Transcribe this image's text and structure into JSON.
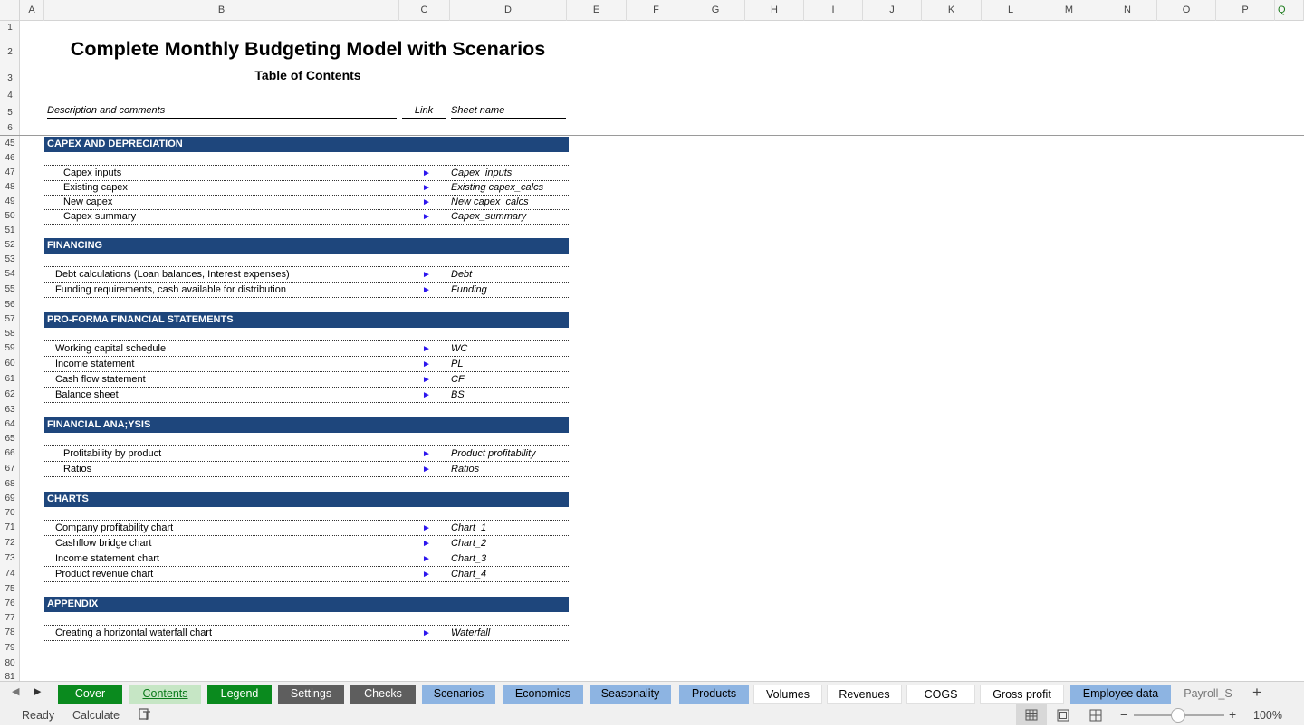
{
  "columns": [
    "A",
    "B",
    "C",
    "D",
    "E",
    "F",
    "G",
    "H",
    "I",
    "J",
    "K",
    "L",
    "M",
    "N",
    "O",
    "P",
    "Q"
  ],
  "rows_top": [
    "1",
    "2",
    "3",
    "4",
    "5",
    "6"
  ],
  "rows_body": [
    "45",
    "46",
    "47",
    "48",
    "49",
    "50",
    "51",
    "52",
    "53",
    "54",
    "55",
    "56",
    "57",
    "58",
    "59",
    "60",
    "61",
    "62",
    "63",
    "64",
    "65",
    "66",
    "67",
    "68",
    "69",
    "70",
    "71",
    "72",
    "73",
    "74",
    "75",
    "76",
    "77",
    "78",
    "79",
    "80",
    "81"
  ],
  "title": "Complete Monthly Budgeting Model with Scenarios",
  "subtitle": "Table of Contents",
  "header": {
    "description": "Description and comments",
    "link": "Link",
    "sheet": "Sheet name"
  },
  "arrow": "►",
  "sections": [
    {
      "title": "CAPEX AND DEPRECIATION",
      "items": [
        {
          "desc": "Capex inputs",
          "sheet": "Capex_inputs",
          "indent": true
        },
        {
          "desc": "Existing capex",
          "sheet": "Existing capex_calcs",
          "indent": true
        },
        {
          "desc": "New capex",
          "sheet": "New capex_calcs",
          "indent": true
        },
        {
          "desc": "Capex summary",
          "sheet": "Capex_summary",
          "indent": true
        }
      ]
    },
    {
      "title": "FINANCING",
      "items": [
        {
          "desc": "Debt calculations (Loan balances, Interest expenses)",
          "sheet": "Debt",
          "indent": false
        },
        {
          "desc": "Funding requirements, cash available for distribution",
          "sheet": "Funding",
          "indent": false
        }
      ]
    },
    {
      "title": "PRO-FORMA FINANCIAL STATEMENTS",
      "items": [
        {
          "desc": "Working capital schedule",
          "sheet": "WC",
          "indent": false
        },
        {
          "desc": "Income statement",
          "sheet": "PL",
          "indent": false
        },
        {
          "desc": "Cash flow statement",
          "sheet": "CF",
          "indent": false
        },
        {
          "desc": "Balance sheet",
          "sheet": "BS",
          "indent": false
        }
      ]
    },
    {
      "title": "FINANCIAL ANA;YSIS",
      "items": [
        {
          "desc": "Profitability by product",
          "sheet": "Product profitability",
          "indent": true
        },
        {
          "desc": "Ratios",
          "sheet": "Ratios",
          "indent": true
        }
      ]
    },
    {
      "title": "CHARTS",
      "items": [
        {
          "desc": "Company profitability chart",
          "sheet": "Chart_1",
          "indent": false
        },
        {
          "desc": "Cashflow bridge chart",
          "sheet": "Chart_2",
          "indent": false
        },
        {
          "desc": "Income statement chart",
          "sheet": "Chart_3",
          "indent": false
        },
        {
          "desc": "Product revenue chart",
          "sheet": "Chart_4",
          "indent": false
        }
      ]
    },
    {
      "title": "APPENDIX",
      "items": [
        {
          "desc": "Creating a horizontal waterfall chart",
          "sheet": "Waterfall",
          "indent": false
        }
      ]
    }
  ],
  "tabs": [
    {
      "label": "Cover",
      "bg": "#0a8a1e",
      "fg": "#ffffff"
    },
    {
      "label": "Contents",
      "bg": "#c6e6c5",
      "fg": "#0a7a1a",
      "active": true
    },
    {
      "label": "Legend",
      "bg": "#0a8a1e",
      "fg": "#ffffff"
    },
    {
      "label": "Settings",
      "bg": "#5e5e5e",
      "fg": "#ffffff"
    },
    {
      "label": "Checks",
      "bg": "#5e5e5e",
      "fg": "#ffffff"
    },
    {
      "label": "Scenarios",
      "bg": "#8db4e2",
      "fg": "#000000"
    },
    {
      "label": "Economics",
      "bg": "#8db4e2",
      "fg": "#000000"
    },
    {
      "label": "Seasonality",
      "bg": "#8db4e2",
      "fg": "#000000"
    },
    {
      "label": "Products",
      "bg": "#8db4e2",
      "fg": "#000000"
    },
    {
      "label": "Volumes",
      "bg": "#ffffff",
      "fg": "#000000"
    },
    {
      "label": "Revenues",
      "bg": "#ffffff",
      "fg": "#000000"
    },
    {
      "label": "COGS",
      "bg": "#ffffff",
      "fg": "#000000"
    },
    {
      "label": "Gross profit",
      "bg": "#ffffff",
      "fg": "#000000"
    },
    {
      "label": "Employee data",
      "bg": "#8db4e2",
      "fg": "#000000"
    },
    {
      "label": "Payroll_S",
      "bg": "#f0f0f0",
      "fg": "#777777"
    }
  ],
  "add_tab": "+",
  "status": {
    "ready": "Ready",
    "calculate": "Calculate",
    "zoom": "100%",
    "zoom_minus": "−",
    "zoom_plus": "+"
  },
  "colors": {
    "section_band": "#1e467c",
    "link_arrow": "#2d16ee"
  }
}
